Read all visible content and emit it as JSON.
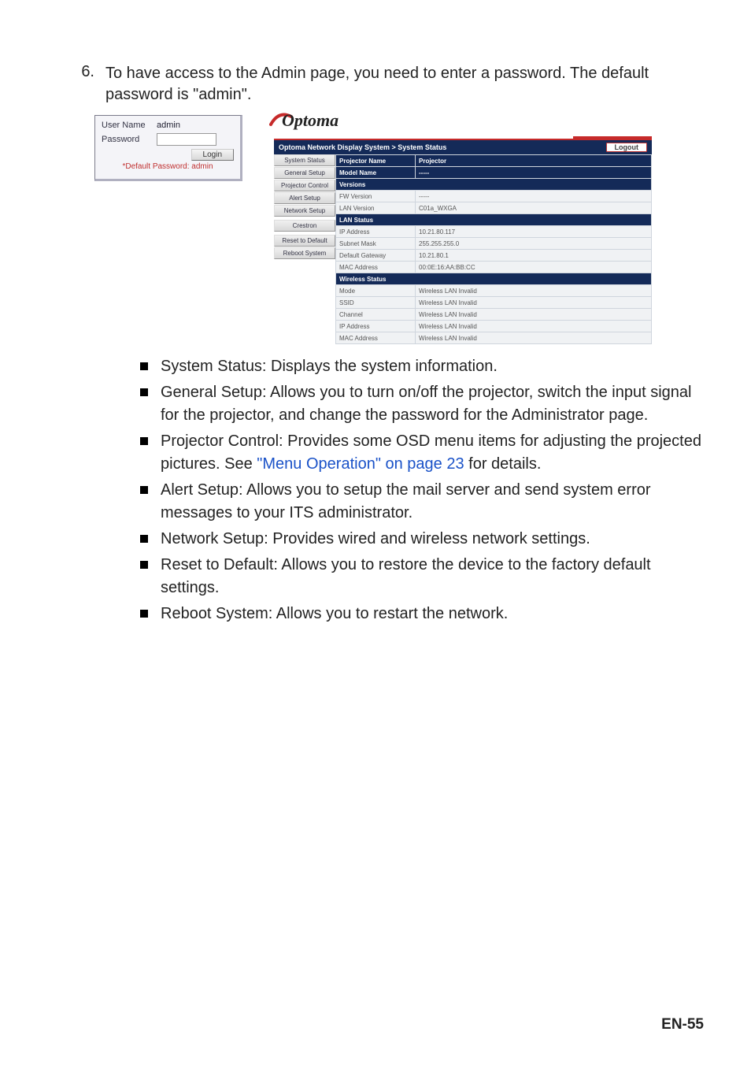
{
  "step": {
    "number": "6.",
    "text_a": "To have access to the Admin page, you need to enter a password. The default password is ",
    "text_b": "\"admin\"",
    "text_c": "."
  },
  "login_panel": {
    "user_label": "User Name",
    "user_value": "admin",
    "pass_label": "Password",
    "login_button": "Login",
    "note": "*Default Password: admin"
  },
  "admin_panel": {
    "logo_text": "Optoma",
    "breadcrumb": "Optoma Network Display System > System Status",
    "logout_label": "Logout",
    "sidebar_items": [
      "System Status",
      "General Setup",
      "Projector Control",
      "Alert Setup",
      "Network Setup",
      "Crestron",
      "Reset to Default",
      "Reboot System"
    ],
    "rows": [
      {
        "type": "hdr",
        "k": "Projector Name",
        "v": "Projector"
      },
      {
        "type": "hdr",
        "k": "Model Name",
        "v": "-----"
      },
      {
        "type": "sec",
        "k": "Versions",
        "v": ""
      },
      {
        "type": "data",
        "k": "FW Version",
        "v": "-----"
      },
      {
        "type": "data",
        "k": "LAN Version",
        "v": "C01a_WXGA"
      },
      {
        "type": "sec",
        "k": "LAN Status",
        "v": ""
      },
      {
        "type": "data",
        "k": "IP Address",
        "v": "10.21.80.117"
      },
      {
        "type": "data",
        "k": "Subnet Mask",
        "v": "255.255.255.0"
      },
      {
        "type": "data",
        "k": "Default Gateway",
        "v": "10.21.80.1"
      },
      {
        "type": "data",
        "k": "MAC Address",
        "v": "00:0E:16:AA:BB:CC"
      },
      {
        "type": "sec",
        "k": "Wireless Status",
        "v": ""
      },
      {
        "type": "data",
        "k": "Mode",
        "v": "Wireless LAN Invalid"
      },
      {
        "type": "data",
        "k": "SSID",
        "v": "Wireless LAN Invalid"
      },
      {
        "type": "data",
        "k": "Channel",
        "v": "Wireless LAN Invalid"
      },
      {
        "type": "data",
        "k": "IP Address",
        "v": "Wireless LAN Invalid"
      },
      {
        "type": "data",
        "k": "MAC Address",
        "v": "Wireless LAN Invalid"
      }
    ]
  },
  "bullets": [
    {
      "parts": [
        {
          "t": "System Status: Displays the system information."
        }
      ]
    },
    {
      "parts": [
        {
          "t": "General Setup: Allows you to turn on/off the projector, switch the input signal for the projector, and change the password for the Administrator page."
        }
      ]
    },
    {
      "parts": [
        {
          "t": "Projector Control: Provides some OSD menu items for adjusting the projected pictures. See "
        },
        {
          "t": "\"Menu Operation\" on page 23",
          "link": true
        },
        {
          "t": " for details."
        }
      ]
    },
    {
      "parts": [
        {
          "t": "Alert Setup: Allows you to setup the mail server and send system error messages to your ITS administrator."
        }
      ]
    },
    {
      "parts": [
        {
          "t": "Network Setup: Provides wired and wireless network settings."
        }
      ]
    },
    {
      "parts": [
        {
          "t": "Reset to Default: Allows you to restore the device to the factory default settings."
        }
      ]
    },
    {
      "parts": [
        {
          "t": "Reboot System: Allows you to restart the network."
        }
      ]
    }
  ],
  "footer": "EN-55"
}
